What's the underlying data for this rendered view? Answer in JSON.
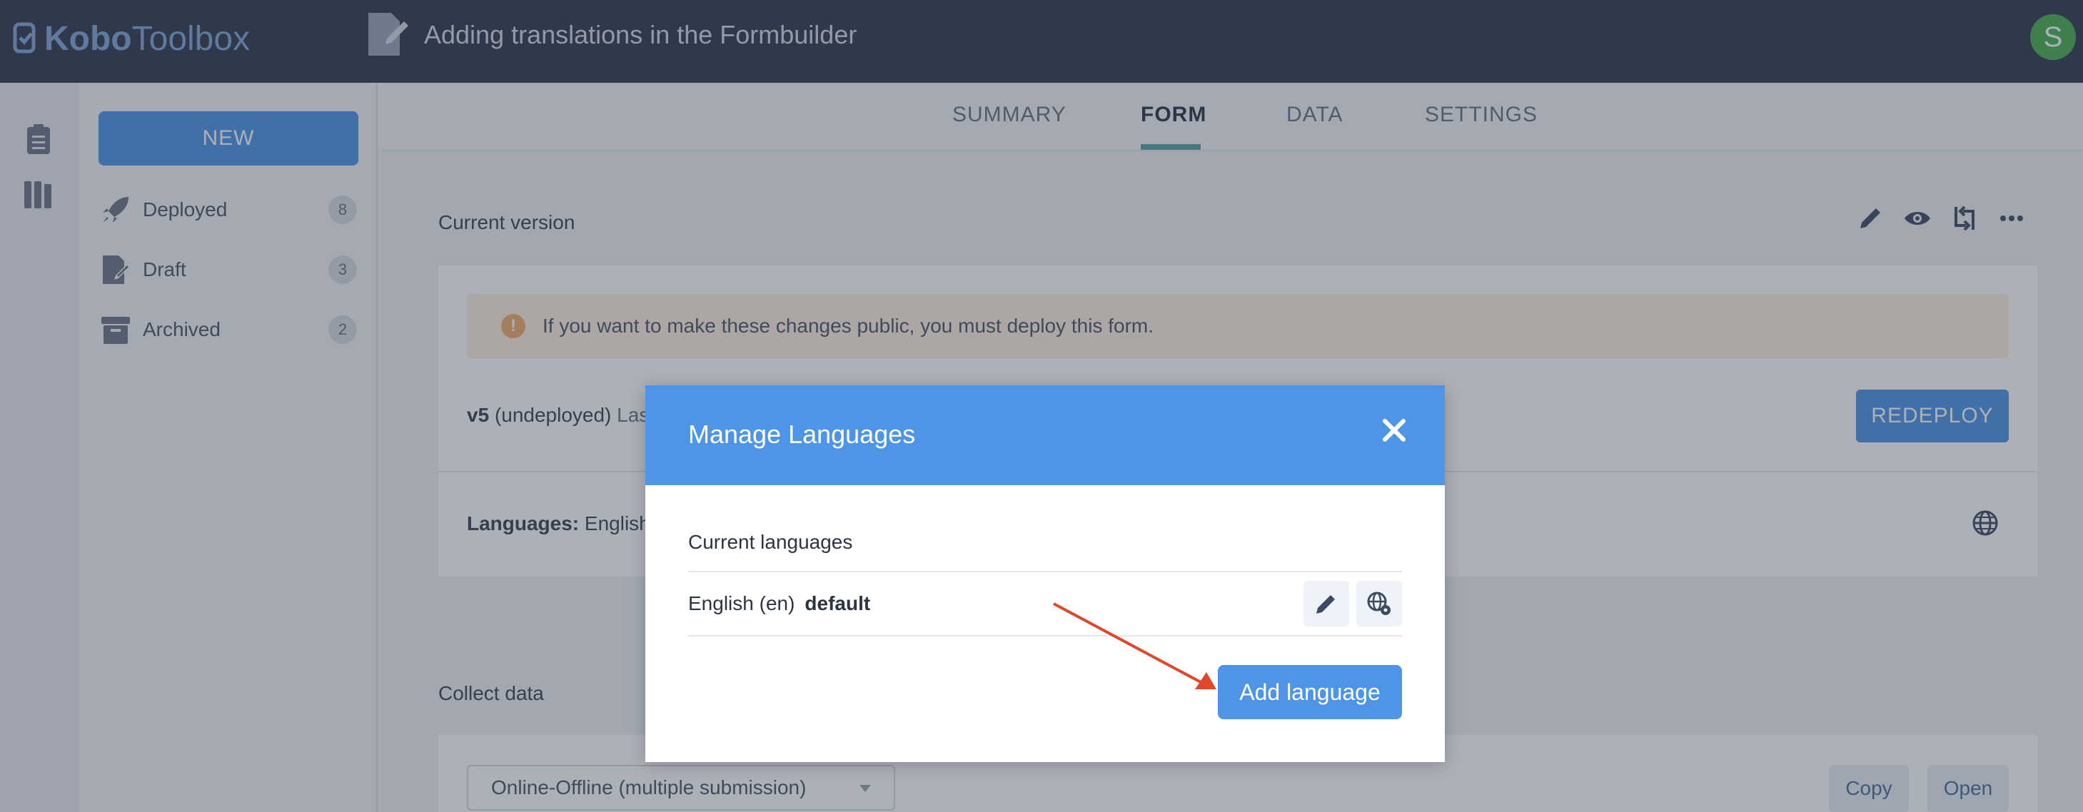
{
  "app": {
    "logo_text_1": "Kobo",
    "logo_text_2": "Toolbox",
    "form_title": "Adding translations in the Formbuilder",
    "avatar_initial": "S"
  },
  "sidebar": {
    "new_label": "NEW",
    "items": [
      {
        "label": "Deployed",
        "count": "8",
        "icon": "rocket-icon"
      },
      {
        "label": "Draft",
        "count": "3",
        "icon": "draft-icon"
      },
      {
        "label": "Archived",
        "count": "2",
        "icon": "archive-icon"
      }
    ]
  },
  "tabs": [
    {
      "label": "SUMMARY"
    },
    {
      "label": "FORM"
    },
    {
      "label": "DATA"
    },
    {
      "label": "SETTINGS"
    }
  ],
  "form_page": {
    "current_version_title": "Current version",
    "alert_text": "If you want to make these changes public, you must deploy this form.",
    "version_label": "v5",
    "version_status": "(undeployed)",
    "version_tail": "Las",
    "redeploy_label": "REDEPLOY",
    "languages_label": "Languages:",
    "languages_value": "English",
    "collect_data_title": "Collect data",
    "collect_select_value": "Online-Offline (multiple submission)",
    "copy_label": "Copy",
    "open_label": "Open"
  },
  "modal": {
    "title": "Manage Languages",
    "current_languages_label": "Current languages",
    "language_name": "English (en)",
    "language_default": "default",
    "add_language_label": "Add language"
  },
  "colors": {
    "topbar": "#2f3a4c",
    "primary": "#4e95e8",
    "alert_bg": "#fff0e2",
    "tab_underline": "#5aa3a3",
    "arrow": "#e0482c"
  }
}
